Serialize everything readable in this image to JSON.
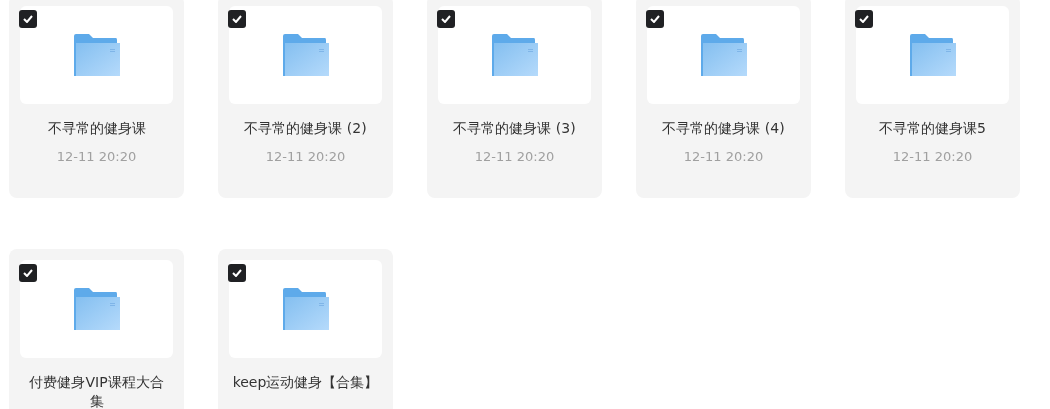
{
  "folders": [
    {
      "name": "不寻常的健身课",
      "date": "12-11 20:20",
      "checked": true
    },
    {
      "name": "不寻常的健身课 (2)",
      "date": "12-11 20:20",
      "checked": true
    },
    {
      "name": "不寻常的健身课 (3)",
      "date": "12-11 20:20",
      "checked": true
    },
    {
      "name": "不寻常的健身课 (4)",
      "date": "12-11 20:20",
      "checked": true
    },
    {
      "name": "不寻常的健身课5",
      "date": "12-11 20:20",
      "checked": true
    },
    {
      "name": "付费健身VIP课程大合集",
      "checked": true
    },
    {
      "name": "keep运动健身【合集】",
      "checked": true
    }
  ]
}
